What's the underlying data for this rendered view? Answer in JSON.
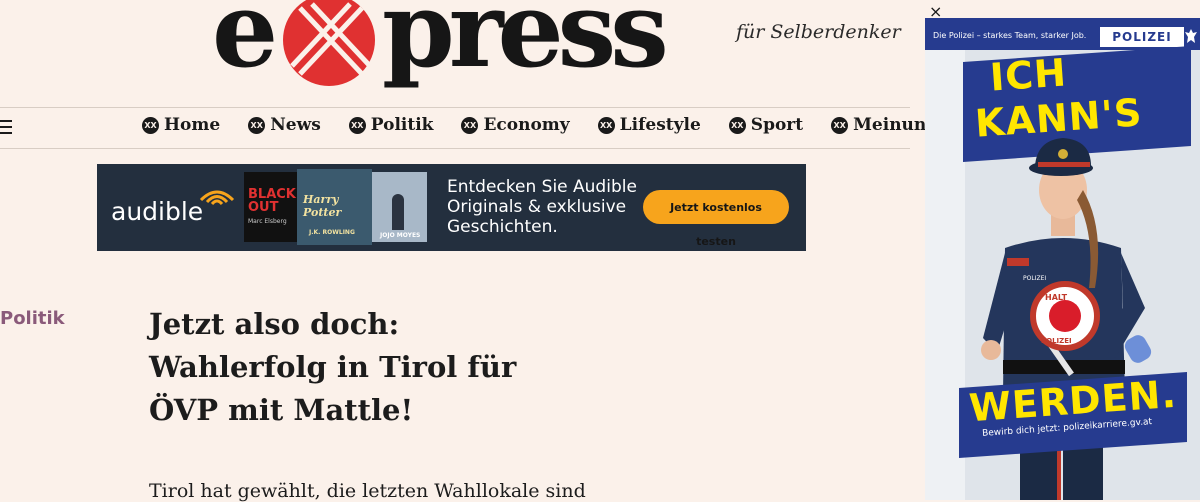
{
  "header": {
    "logo_text": "express",
    "tagline": "für Selberdenker"
  },
  "nav": {
    "items": [
      {
        "label": "Home"
      },
      {
        "label": "News"
      },
      {
        "label": "Politik"
      },
      {
        "label": "Economy"
      },
      {
        "label": "Lifestyle"
      },
      {
        "label": "Sport"
      },
      {
        "label": "Meinung"
      }
    ],
    "icon_glyph": "XX"
  },
  "audible_ad": {
    "brand": "audible",
    "text": "Entdecken Sie Audible Originals & exklusive Geschichten.",
    "button": "Jetzt kostenlos testen",
    "cover_1": "BLACK OUT",
    "cover_1_author": "Marc Elsberg",
    "cover_2": "Harry Potter",
    "cover_2_author": "J.K. ROWLING",
    "cover_3_author": "JOJO MOYES",
    "colors": {
      "bg": "#232f3e",
      "button": "#f7a41c"
    }
  },
  "article": {
    "section": "Politik",
    "headline": "Jetzt also doch: Wahlerfolg in Tirol für ÖVP mit Mattle!",
    "lead": "Tirol hat gewählt, die letzten Wahllokale sind"
  },
  "side_ad": {
    "close_symbol": "×",
    "slogan": "Die Polizei – starkes Team, starker Job.",
    "brand": "POLIZEI",
    "headline_1": "ICH",
    "headline_2": "KANN'S",
    "headline_3": "WERDEN.",
    "url_text": "Bewirb dich jetzt: polizeikarriere.gv.at",
    "sign_text_1": "HALT",
    "sign_text_2": "POLIZEI",
    "badge_text": "POLIZEI",
    "colors": {
      "blue": "#263b8f",
      "yellow": "#ffe600"
    }
  }
}
